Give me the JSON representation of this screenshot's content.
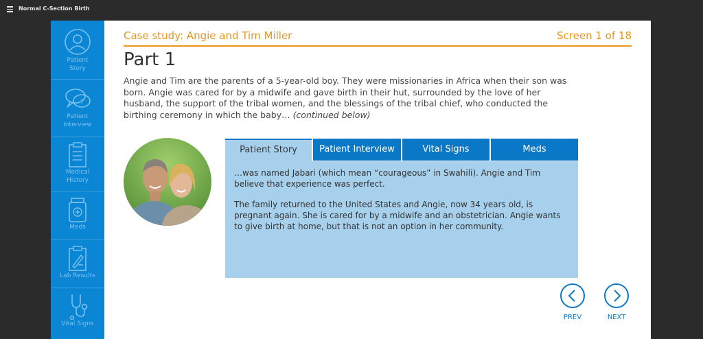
{
  "app": {
    "title": "Normal C-Section Birth",
    "menu_icon": "hamburger-icon"
  },
  "sidebar": {
    "items": [
      {
        "label_1": "Patient",
        "label_2": "Story",
        "icon": "user-circle-icon"
      },
      {
        "label_1": "Patient",
        "label_2": "Interview",
        "icon": "speech-bubble-icon"
      },
      {
        "label_1": "Medical",
        "label_2": "History",
        "icon": "clipboard-icon"
      },
      {
        "label_1": "Meds",
        "label_2": "",
        "icon": "medicine-bottle-icon"
      },
      {
        "label_1": "Lab Results",
        "label_2": "",
        "icon": "lab-clipboard-icon"
      },
      {
        "label_1": "Vital Signs",
        "label_2": "",
        "icon": "stethoscope-icon"
      }
    ]
  },
  "header": {
    "case_title": "Case study: Angie and Tim Miller",
    "screen_count": "Screen 1 of 18",
    "part_title": "Part 1"
  },
  "intro": {
    "text": "Angie and Tim are the parents of a 5-year-old boy. They were missionaries in Africa when their son was born. Angie was cared for by a midwife and gave birth in their hut, surrounded by the love of her husband, the support of the tribal women, and the blessings of the tribal chief, who conducted the birthing ceremony in which the baby…",
    "continued": "(continued below)"
  },
  "tabs": [
    {
      "label": "Patient Story",
      "active": true
    },
    {
      "label": "Patient Interview",
      "active": false
    },
    {
      "label": "Vital Signs",
      "active": false
    },
    {
      "label": "Meds",
      "active": false
    }
  ],
  "tab_content": {
    "p1": "…was named Jabari (which mean “courageous” in Swahili). Angie and Tim believe that experience was perfect.",
    "p2": "The family returned to the United States and Angie, now 34 years old, is pregnant again. She is cared for by a midwife and an obstetrician. Angie wants to give birth at home, but that is not an option in her community."
  },
  "nav": {
    "prev_label": "PREV",
    "next_label": "NEXT"
  },
  "colors": {
    "accent": "#e8961c",
    "sidebar": "#0b86d4",
    "tab": "#0a78c6",
    "panel": "#a6d0ec"
  }
}
